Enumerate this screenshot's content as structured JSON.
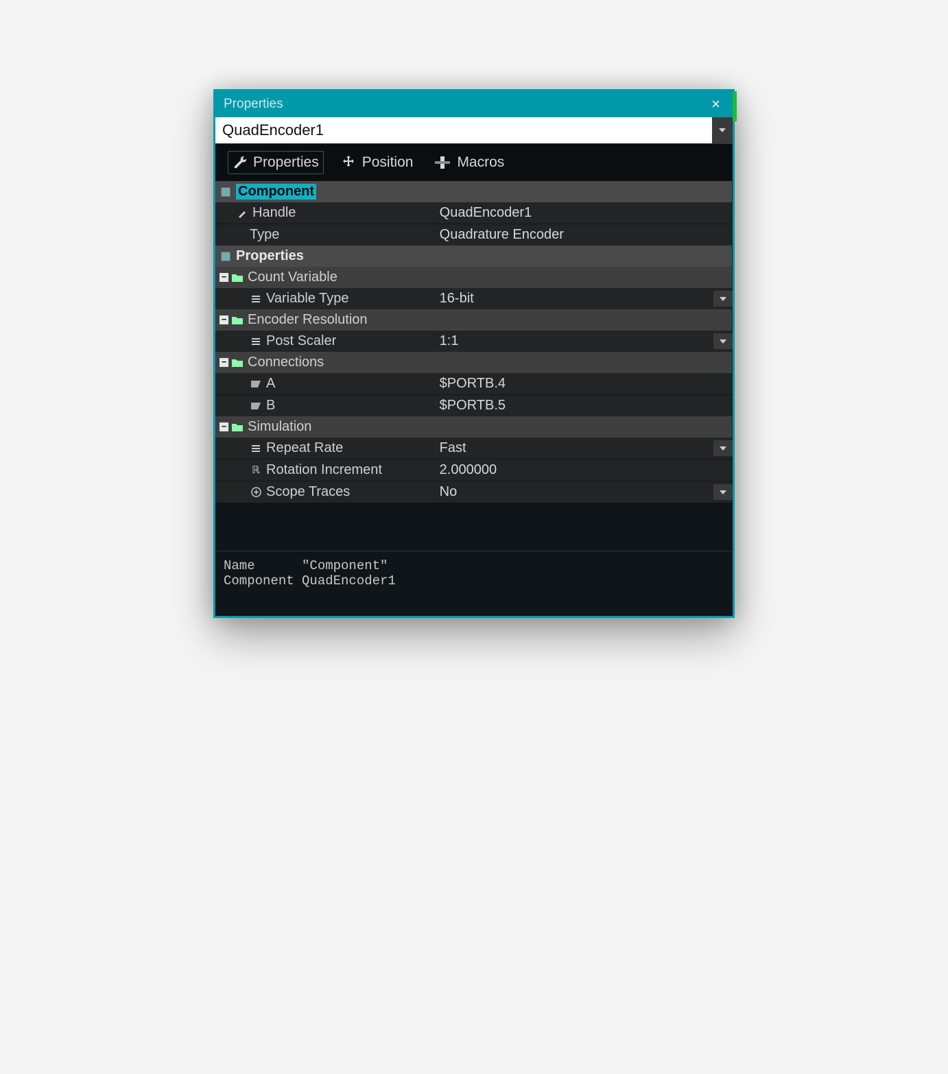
{
  "window": {
    "title": "Properties"
  },
  "selector": {
    "value": "QuadEncoder1"
  },
  "tabs": {
    "properties": "Properties",
    "position": "Position",
    "macros": "Macros"
  },
  "sections": {
    "component": {
      "label": "Component",
      "handle_label": "Handle",
      "handle_value": "QuadEncoder1",
      "type_label": "Type",
      "type_value": "Quadrature Encoder"
    },
    "properties": {
      "label": "Properties",
      "count_variable": {
        "label": "Count Variable",
        "variable_type_label": "Variable Type",
        "variable_type_value": "16-bit"
      },
      "encoder_resolution": {
        "label": "Encoder Resolution",
        "post_scaler_label": "Post Scaler",
        "post_scaler_value": "1:1"
      },
      "connections": {
        "label": "Connections",
        "a_label": "A",
        "a_value": "$PORTB.4",
        "b_label": "B",
        "b_value": "$PORTB.5"
      },
      "simulation": {
        "label": "Simulation",
        "repeat_rate_label": "Repeat Rate",
        "repeat_rate_value": "Fast",
        "rotation_increment_label": "Rotation Increment",
        "rotation_increment_value": "2.000000",
        "scope_traces_label": "Scope Traces",
        "scope_traces_value": "No"
      }
    }
  },
  "status": {
    "line1": "Name      \"Component\"",
    "line2": "Component QuadEncoder1"
  }
}
